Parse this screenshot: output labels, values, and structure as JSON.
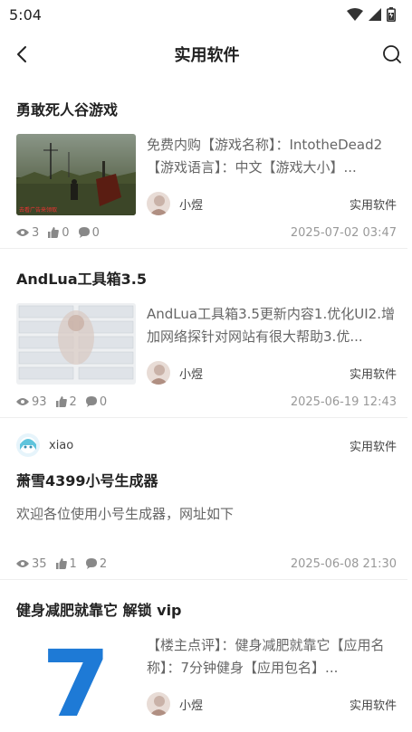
{
  "status": {
    "time": "5:04"
  },
  "header": {
    "title": "实用软件"
  },
  "posts": [
    {
      "title": "勇敢死人谷游戏",
      "excerpt": "免费内购【游戏名称】：IntotheDead2【游戏语言】：中文【游戏大小】...",
      "author": "小煜",
      "category": "实用软件",
      "views": "3",
      "likes": "0",
      "comments": "0",
      "date": "2025-07-02 03:47"
    },
    {
      "title": "AndLua工具箱3.5",
      "excerpt": "AndLua工具箱3.5更新内容1.优化UI2.增加网络探针对网站有很大帮助3.优...",
      "author": "小煜",
      "category": "实用软件",
      "views": "93",
      "likes": "2",
      "comments": "0",
      "date": "2025-06-19 12:43"
    },
    {
      "author": "xiao",
      "category": "实用软件",
      "title": "萧雪4399小号生成器",
      "excerpt": "欢迎各位使用小号生成器，网址如下",
      "views": "35",
      "likes": "1",
      "comments": "2",
      "date": "2025-06-08 21:30"
    },
    {
      "title": "健身减肥就靠它 解锁 vip",
      "excerpt": "【楼主点评】：健身减肥就靠它【应用名称】：7分钟健身【应用包名】...",
      "thumb_text": "7",
      "author": "小煜",
      "category": "实用软件"
    }
  ]
}
